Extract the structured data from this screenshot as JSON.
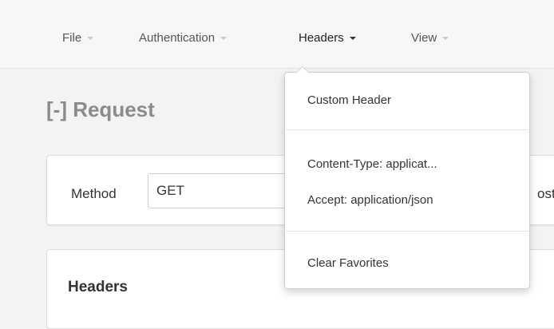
{
  "navbar": {
    "items": [
      {
        "label": "File",
        "active": false
      },
      {
        "label": "Authentication",
        "active": false
      },
      {
        "label": "Headers",
        "active": true
      },
      {
        "label": "View",
        "active": false
      }
    ]
  },
  "request": {
    "title": "[-] Request",
    "method_label": "Method",
    "method_value": "GET",
    "host_fragment": "ost:"
  },
  "headers_panel": {
    "title": "Headers"
  },
  "headers_menu": {
    "items": [
      {
        "label": "Custom Header"
      },
      {
        "label": "Content-Type: applicat..."
      },
      {
        "label": "Accept: application/json"
      },
      {
        "label": "Clear Favorites"
      }
    ]
  },
  "colors": {
    "navbar_bg": "#f7f7f7",
    "page_bg": "#f3f3f3",
    "title_gray": "#8b8b8b"
  }
}
